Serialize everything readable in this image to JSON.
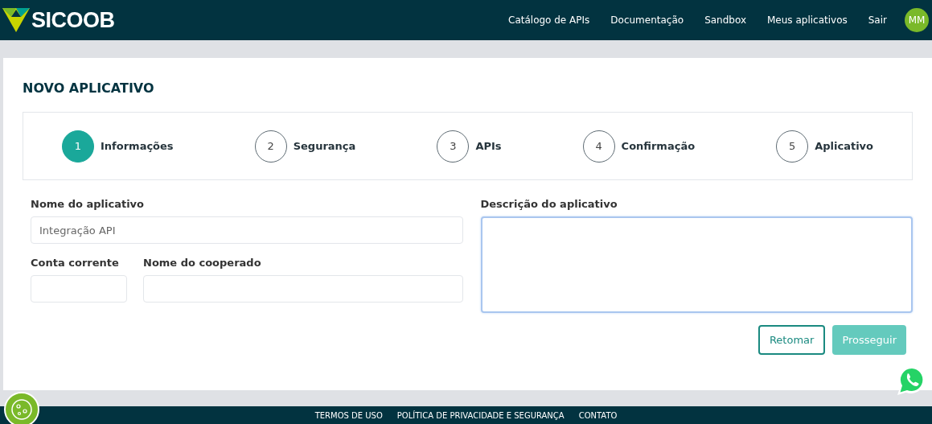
{
  "header": {
    "logo": "SICOOB",
    "nav": [
      {
        "label": "Catálogo de APIs"
      },
      {
        "label": "Documentação"
      },
      {
        "label": "Sandbox"
      },
      {
        "label": "Meus aplicativos"
      },
      {
        "label": "Sair"
      }
    ],
    "avatar": "MM"
  },
  "page": {
    "title": "NOVO APLICATIVO"
  },
  "steps": [
    {
      "number": "1",
      "label": "Informações",
      "selected": true
    },
    {
      "number": "2",
      "label": "Segurança",
      "selected": false
    },
    {
      "number": "3",
      "label": "APIs",
      "selected": false
    },
    {
      "number": "4",
      "label": "Confirmação",
      "selected": false
    },
    {
      "number": "5",
      "label": "Aplicativo",
      "selected": false
    }
  ],
  "form": {
    "app_name": {
      "label": "Nome do aplicativo",
      "value": "Integração API"
    },
    "account": {
      "label": "Conta corrente"
    },
    "member_name": {
      "label": "Nome do cooperado"
    },
    "description": {
      "label": "Descrição do aplicativo",
      "focused": true
    }
  },
  "buttons": [
    {
      "label": "Retomar",
      "disabled": false,
      "kind": "outline"
    },
    {
      "label": "Prosseguir",
      "disabled": true,
      "kind": "primary"
    }
  ],
  "footer": {
    "links": [
      "TERMOS DE USO",
      "POLÍTICA DE PRIVACIDADE E SEGURANÇA",
      "CONTATO"
    ]
  }
}
